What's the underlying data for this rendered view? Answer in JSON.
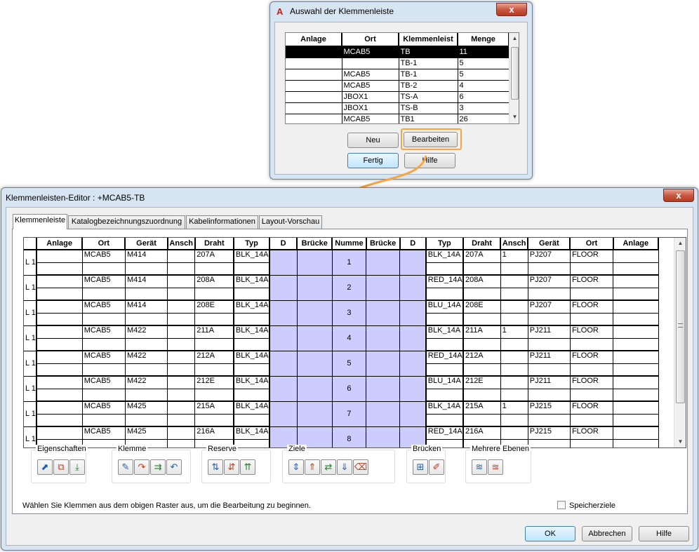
{
  "dialog1": {
    "title": "Auswahl der Klemmenleiste",
    "app_icon": "A",
    "close_label": "x",
    "columns": [
      "Anlage",
      "Ort",
      "Klemmenleist",
      "Menge"
    ],
    "rows": [
      [
        "",
        "MCAB5",
        "TB",
        "11"
      ],
      [
        "",
        "",
        "TB-1",
        "5"
      ],
      [
        "",
        "MCAB5",
        "TB-1",
        "5"
      ],
      [
        "",
        "MCAB5",
        "TB-2",
        "4"
      ],
      [
        "",
        "JBOX1",
        "TS-A",
        "6"
      ],
      [
        "",
        "JBOX1",
        "TS-B",
        "3"
      ],
      [
        "",
        "MCAB5",
        "TB1",
        "26"
      ]
    ],
    "selected_row": 0,
    "buttons": {
      "new": "Neu",
      "edit": "Bearbeiten",
      "done": "Fertig",
      "help": "Hilfe"
    },
    "highlight_color": "#f5a545"
  },
  "arrow_color": "#f5a545",
  "dialog2": {
    "title": "Klemmenleisten-Editor : +MCAB5-TB",
    "close_label": "x",
    "tabs": [
      "Klemmenleiste",
      "Katalogbezeichnungszuordnung",
      "Kabelinformationen",
      "Layout-Vorschau"
    ],
    "active_tab": 0,
    "columns": [
      "",
      "Anlage",
      "Ort",
      "Gerät",
      "Ansch",
      "Draht",
      "Typ",
      "D",
      "Brücke",
      "Numme",
      "Brücke",
      "D",
      "Typ",
      "Draht",
      "Ansch",
      "Gerät",
      "Ort",
      "Anlage"
    ],
    "terminal_fill": "#ccccff",
    "rows": [
      {
        "label": "L 1",
        "left": [
          "",
          "MCAB5",
          "M414",
          "",
          "207A",
          "BLK_14A"
        ],
        "num": "1",
        "right": [
          "BLK_14A",
          "207A",
          "1",
          "PJ207",
          "FLOOR",
          ""
        ]
      },
      {
        "label": "L 1",
        "left": [
          "",
          "MCAB5",
          "M414",
          "",
          "208A",
          "BLK_14A"
        ],
        "num": "2",
        "right": [
          "RED_14A",
          "208A",
          "",
          "PJ207",
          "FLOOR",
          ""
        ]
      },
      {
        "label": "L 1",
        "left": [
          "",
          "MCAB5",
          "M414",
          "",
          "208E",
          "BLK_14A"
        ],
        "num": "3",
        "right": [
          "BLU_14A",
          "208E",
          "",
          "PJ207",
          "FLOOR",
          ""
        ]
      },
      {
        "label": "L 1",
        "left": [
          "",
          "MCAB5",
          "M422",
          "",
          "211A",
          "BLK_14A"
        ],
        "num": "4",
        "right": [
          "BLK_14A",
          "211A",
          "1",
          "PJ211",
          "FLOOR",
          ""
        ]
      },
      {
        "label": "L 1",
        "left": [
          "",
          "MCAB5",
          "M422",
          "",
          "212A",
          "BLK_14A"
        ],
        "num": "5",
        "right": [
          "RED_14A",
          "212A",
          "",
          "PJ211",
          "FLOOR",
          ""
        ]
      },
      {
        "label": "L 1",
        "left": [
          "",
          "MCAB5",
          "M422",
          "",
          "212E",
          "BLK_14A"
        ],
        "num": "6",
        "right": [
          "BLU_14A",
          "212E",
          "",
          "PJ211",
          "FLOOR",
          ""
        ]
      },
      {
        "label": "L 1",
        "left": [
          "",
          "MCAB5",
          "M425",
          "",
          "215A",
          "BLK_14A"
        ],
        "num": "7",
        "right": [
          "BLK_14A",
          "215A",
          "1",
          "PJ215",
          "FLOOR",
          ""
        ]
      },
      {
        "label": "L 1",
        "left": [
          "",
          "MCAB5",
          "M425",
          "",
          "216A",
          "BLK_14A"
        ],
        "num": "8",
        "right": [
          "RED_14A",
          "216A",
          "",
          "PJ215",
          "FLOOR",
          ""
        ]
      }
    ],
    "groups": [
      {
        "label": "Eigenschaften",
        "icons": [
          "terminal-properties-icon",
          "multi-level-properties-icon",
          "edit-properties-icon"
        ],
        "glyphs": [
          "⬈",
          "⧉",
          "⤓"
        ]
      },
      {
        "label": "Klemme",
        "icons": [
          "new-terminal-icon",
          "move-terminal-icon",
          "insert-terminal-icon",
          "rotate-terminal-icon"
        ],
        "glyphs": [
          "✎",
          "↷",
          "⇉",
          "↶"
        ]
      },
      {
        "label": "Reserve",
        "icons": [
          "add-spare-icon",
          "insert-spare-icon",
          "remove-spare-icon"
        ],
        "glyphs": [
          "⇅",
          "⇵",
          "⇈"
        ]
      },
      {
        "label": "Ziele",
        "icons": [
          "reorder-destinations-icon",
          "move-destinations-up-icon",
          "reverse-destinations-icon",
          "move-destinations-down-icon",
          "clear-destinations-icon"
        ],
        "glyphs": [
          "⇕",
          "⇑",
          "⇄",
          "⇓",
          "⌫"
        ]
      },
      {
        "label": "Brücken",
        "icons": [
          "add-jumper-icon",
          "edit-jumper-icon"
        ],
        "glyphs": [
          "⊞",
          "✐"
        ]
      },
      {
        "label": "Mehrere Ebenen",
        "icons": [
          "multi-level-icon",
          "multi-level-edit-icon"
        ],
        "glyphs": [
          "≋",
          "≊"
        ]
      }
    ],
    "instruction": "Wählen Sie Klemmen aus dem obigen Raster aus, um die Bearbeitung zu beginnen.",
    "checkbox_label": "Speicherziele",
    "buttons": {
      "ok": "OK",
      "cancel": "Abbrechen",
      "help": "Hilfe"
    }
  }
}
